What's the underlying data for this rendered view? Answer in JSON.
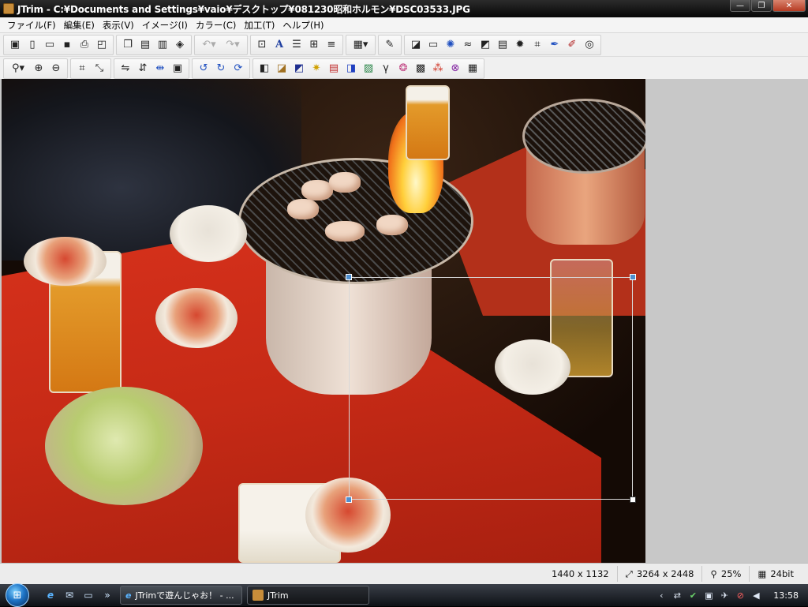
{
  "window": {
    "title": "JTrim - C:¥Documents and Settings¥vaio¥デスクトップ¥081230昭和ホルモン¥DSC03533.JPG",
    "minimize_symbol": "—",
    "restore_symbol": "❐",
    "close_symbol": "✕"
  },
  "menubar": {
    "items": [
      {
        "label": "ファイル(F)"
      },
      {
        "label": "編集(E)"
      },
      {
        "label": "表示(V)"
      },
      {
        "label": "イメージ(I)"
      },
      {
        "label": "カラー(C)"
      },
      {
        "label": "加工(T)"
      },
      {
        "label": "ヘルプ(H)"
      }
    ]
  },
  "toolbar1": {
    "groups": [
      [
        "new-window-icon",
        "new-file-icon",
        "open-folder-icon",
        "save-icon",
        "print-icon",
        "print-preview-icon"
      ],
      [
        "copy-icon",
        "paste-icon",
        "paste-new-icon",
        "capture-icon"
      ],
      [
        "undo-icon",
        "redo-icon"
      ],
      [
        "fit-window-icon",
        "text-icon",
        "align-icon",
        "tile-icon",
        "scanline-icon"
      ],
      [
        "mosaic-grid-icon"
      ],
      [
        "eyedropper-icon"
      ],
      [
        "shadow-icon",
        "frame-icon",
        "sparkle-icon",
        "wave-icon",
        "emboss-icon",
        "stripe-icon",
        "starburst-icon",
        "noise-icon",
        "pen-icon",
        "eraser-icon",
        "spiral-icon"
      ]
    ]
  },
  "toolbar2": {
    "groups": [
      [
        "zoom-dropdown-icon",
        "zoom-in-icon",
        "zoom-out-icon"
      ],
      [
        "crop-icon",
        "resize-icon"
      ],
      [
        "flip-horizontal-icon",
        "flip-vertical-icon",
        "mirror-icon",
        "canvas-icon"
      ],
      [
        "rotate-left-90-icon",
        "rotate-right-90-icon",
        "rotate-free-icon"
      ],
      [
        "gradient-icon",
        "sepia-icon",
        "negative-icon",
        "brightness-icon",
        "color-balance-icon",
        "hue-icon",
        "image-adjust-icon",
        "gamma-icon",
        "color-wheel-icon",
        "mosaic-icon",
        "rgb-icon",
        "xor-icon",
        "grayscale-icon"
      ]
    ]
  },
  "selection": {
    "present": true
  },
  "statusbar": {
    "selection_size": "1440 x 1132",
    "image_size": "3264 x 2448",
    "zoom": "25%",
    "bit_depth": "24bit"
  },
  "taskbar": {
    "tasks": [
      {
        "label": "JTrimで遊んじゃお！ - ...",
        "icon": "ie-icon"
      },
      {
        "label": "JTrim",
        "icon": "jtrim-icon"
      }
    ],
    "clock": "13:58"
  },
  "colors": {
    "title_bar": "#0f0f0f",
    "selection_handle": "#4f8fcf",
    "workspace_bg": "#c8c8c8",
    "table_red": "#c62a16"
  }
}
